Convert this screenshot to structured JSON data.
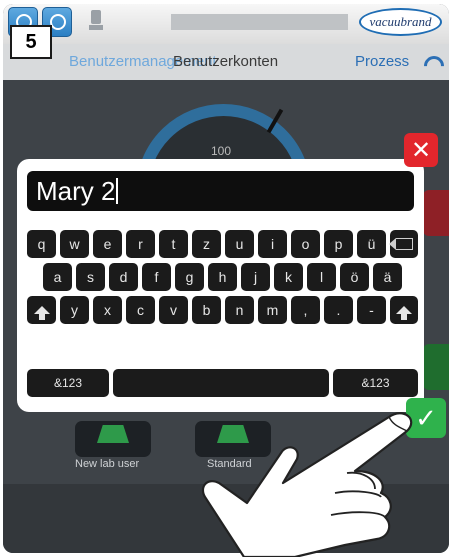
{
  "step": "5",
  "logo": "vacuubrand",
  "tabs": {
    "inactive": "Benutzermanagement",
    "active": "Benutzerkonten",
    "process": "Prozess"
  },
  "gauge": {
    "value": "100"
  },
  "input": {
    "value": "Mary 2"
  },
  "keyboard": {
    "row1": [
      "q",
      "w",
      "e",
      "r",
      "t",
      "z",
      "u",
      "i",
      "o",
      "p",
      "ü"
    ],
    "row2": [
      "a",
      "s",
      "d",
      "f",
      "g",
      "h",
      "j",
      "k",
      "l",
      "ö",
      "ä"
    ],
    "row3": [
      "y",
      "x",
      "c",
      "v",
      "b",
      "n",
      "m",
      ",",
      ".",
      "-"
    ],
    "mode_left": "&123",
    "mode_right": "&123",
    "icons": {
      "backspace": "backspace-icon",
      "shift": "shift-icon"
    }
  },
  "tiles": {
    "new_user": "New lab user",
    "standard": "Standard"
  },
  "colors": {
    "close": "#e2262c",
    "confirm": "#2fb24c",
    "accent": "#2c6fb5"
  }
}
